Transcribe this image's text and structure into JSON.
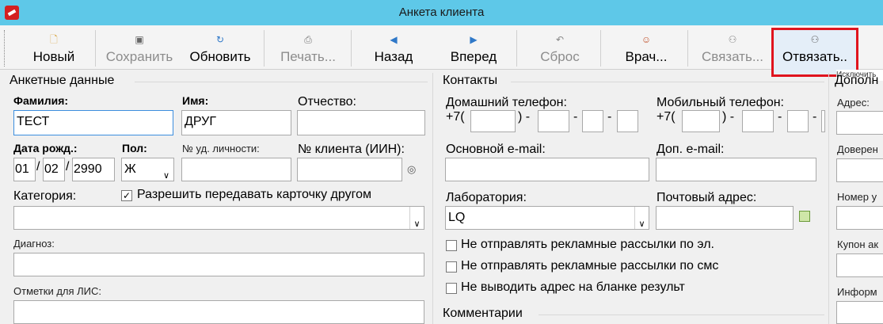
{
  "window": {
    "title": "Анкета клиента"
  },
  "toolbar": {
    "new": "Новый",
    "save": "Сохранить",
    "refresh": "Обновить",
    "print": "Печать...",
    "back": "Назад",
    "forward": "Вперед",
    "reset": "Сброс",
    "doctor": "Врач...",
    "link": "Связать...",
    "unlink": "Отвязать..",
    "tooltip": "Исключить"
  },
  "profile": {
    "title": "Анкетные данные",
    "last_name_label": "Фамилия:",
    "last_name_value": "ТЕСТ",
    "first_name_label": "Имя:",
    "first_name_value": "ДРУГ",
    "patronymic_label": "Отчество:",
    "dob_label": "Дата рожд.:",
    "dob_day": "01",
    "dob_month": "02",
    "dob_year": "2990",
    "sex_label": "Пол:",
    "sex_value": "Ж",
    "id_label": "№ уд. личности:",
    "client_no_label": "№ клиента (ИИН):",
    "category_label": "Категория:",
    "share_label": "Разрешить передавать карточку другом",
    "diagnosis_label": "Диагноз:",
    "lis_label": "Отметки для ЛИС:"
  },
  "contacts": {
    "title": "Контакты",
    "home_phone_label": "Домашний телефон:",
    "mobile_phone_label": "Мобильный телефон:",
    "phone_prefix": "+7(",
    "phone_close": ") -",
    "dash": "-",
    "email_label": "Основной e-mail:",
    "email2_label": "Доп. e-mail:",
    "lab_label": "Лаборатория:",
    "lab_value": "LQ",
    "postal_label": "Почтовый адрес:",
    "opt1": "Не отправлять рекламные рассылки по эл.",
    "opt2": "Не отправлять рекламные рассылки по смс",
    "opt3": "Не выводить адрес на бланке результ"
  },
  "comments": {
    "title": "Комментарии"
  },
  "extra": {
    "title": "Дополн",
    "address_label": "Адрес:",
    "trustee_label": "Доверен",
    "number_label": "Номер у",
    "coupon_label": "Купон ак",
    "info_label": "Информ"
  }
}
